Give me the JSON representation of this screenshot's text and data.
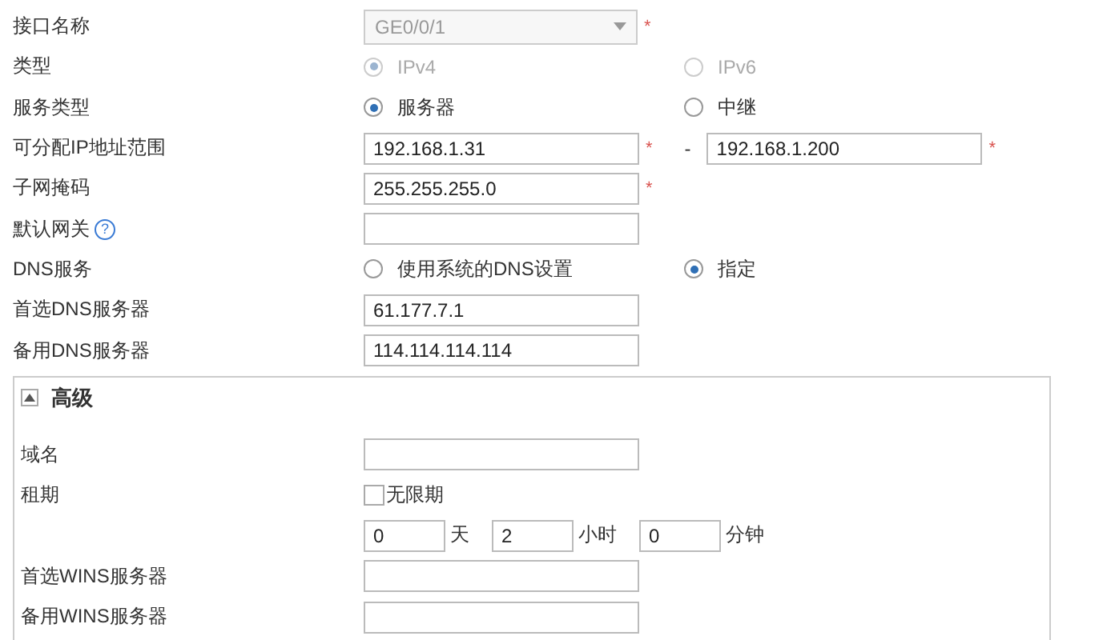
{
  "fields": [
    {
      "kind": "select",
      "label": "接口名称",
      "value": "GE0/0/1",
      "disabled": true,
      "required_mark": "*"
    },
    {
      "kind": "radio",
      "label": "类型",
      "disabled": true,
      "options": [
        {
          "label": "IPv4",
          "selected": true
        },
        {
          "label": "IPv6",
          "selected": false
        }
      ]
    },
    {
      "kind": "radio",
      "label": "服务类型",
      "disabled": false,
      "options": [
        {
          "label": "服务器",
          "selected": true
        },
        {
          "label": "中继",
          "selected": false
        }
      ]
    },
    {
      "kind": "range",
      "label": "可分配IP地址范围",
      "from": "192.168.1.31",
      "separator": "-",
      "to": "192.168.1.200",
      "required_mark": "*"
    },
    {
      "kind": "text",
      "label": "子网掩码",
      "value": "255.255.255.0",
      "required_mark": "*"
    },
    {
      "kind": "text",
      "label": "默认网关",
      "help": "?"
    },
    {
      "kind": "radio",
      "label": "DNS服务",
      "disabled": false,
      "options": [
        {
          "label": "使用系统的DNS设置",
          "selected": false
        },
        {
          "label": "指定",
          "selected": true
        }
      ]
    },
    {
      "kind": "text",
      "label": "首选DNS服务器",
      "value": "61.177.7.1"
    },
    {
      "kind": "text",
      "label": "备用DNS服务器",
      "value": "114.114.114.114"
    }
  ],
  "advanced": {
    "title": "高级",
    "expanded": true,
    "fields": [
      {
        "kind": "text",
        "label": "域名"
      },
      {
        "kind": "checkbox",
        "label": "租期",
        "option": "无限期",
        "checked": false
      },
      {
        "kind": "duration",
        "parts": [
          {
            "value": "0",
            "unit": "天"
          },
          {
            "value": "2",
            "unit": "小时"
          },
          {
            "value": "0",
            "unit": "分钟"
          }
        ]
      },
      {
        "kind": "text",
        "label": "首选WINS服务器"
      },
      {
        "kind": "text",
        "label": "备用WINS服务器"
      }
    ]
  }
}
